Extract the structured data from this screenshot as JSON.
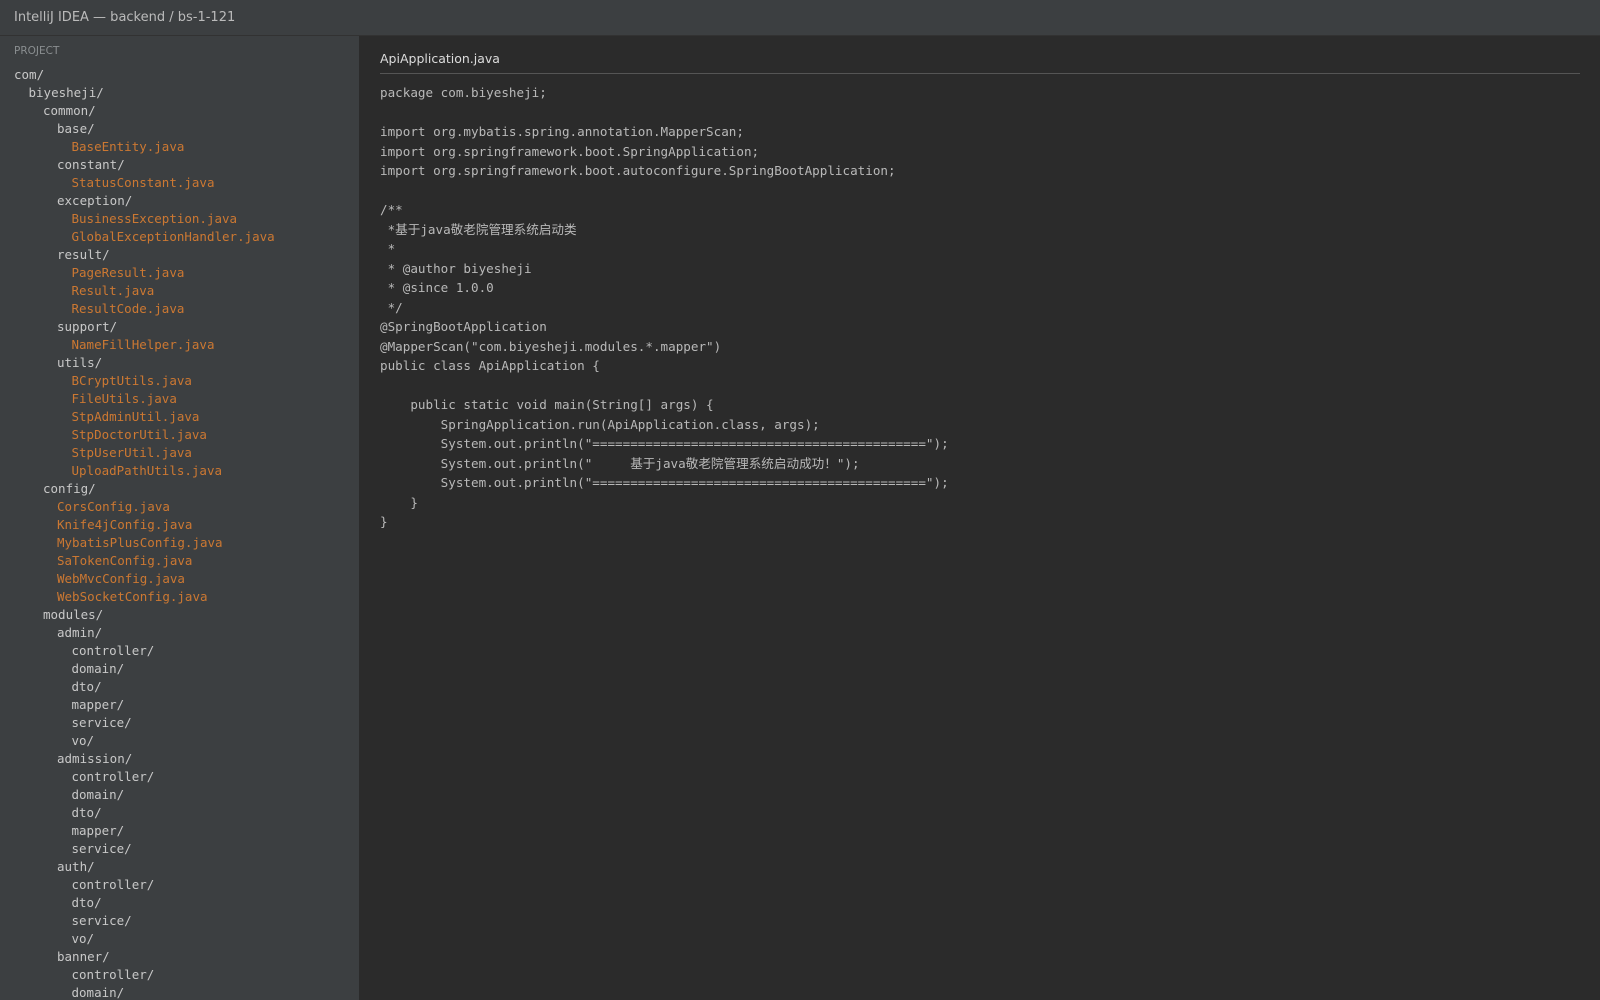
{
  "window": {
    "title": "IntelliJ IDEA — backend / bs-1-121"
  },
  "sidebar": {
    "section_title": "PROJECT",
    "tree": [
      {
        "label": "com/",
        "depth": 0,
        "kind": "dir"
      },
      {
        "label": "biyesheji/",
        "depth": 1,
        "kind": "dir"
      },
      {
        "label": "common/",
        "depth": 2,
        "kind": "dir"
      },
      {
        "label": "base/",
        "depth": 3,
        "kind": "dir"
      },
      {
        "label": "BaseEntity.java",
        "depth": 4,
        "kind": "file"
      },
      {
        "label": "constant/",
        "depth": 3,
        "kind": "dir"
      },
      {
        "label": "StatusConstant.java",
        "depth": 4,
        "kind": "file"
      },
      {
        "label": "exception/",
        "depth": 3,
        "kind": "dir"
      },
      {
        "label": "BusinessException.java",
        "depth": 4,
        "kind": "file"
      },
      {
        "label": "GlobalExceptionHandler.java",
        "depth": 4,
        "kind": "file"
      },
      {
        "label": "result/",
        "depth": 3,
        "kind": "dir"
      },
      {
        "label": "PageResult.java",
        "depth": 4,
        "kind": "file"
      },
      {
        "label": "Result.java",
        "depth": 4,
        "kind": "file"
      },
      {
        "label": "ResultCode.java",
        "depth": 4,
        "kind": "file"
      },
      {
        "label": "support/",
        "depth": 3,
        "kind": "dir"
      },
      {
        "label": "NameFillHelper.java",
        "depth": 4,
        "kind": "file"
      },
      {
        "label": "utils/",
        "depth": 3,
        "kind": "dir"
      },
      {
        "label": "BCryptUtils.java",
        "depth": 4,
        "kind": "file"
      },
      {
        "label": "FileUtils.java",
        "depth": 4,
        "kind": "file"
      },
      {
        "label": "StpAdminUtil.java",
        "depth": 4,
        "kind": "file"
      },
      {
        "label": "StpDoctorUtil.java",
        "depth": 4,
        "kind": "file"
      },
      {
        "label": "StpUserUtil.java",
        "depth": 4,
        "kind": "file"
      },
      {
        "label": "UploadPathUtils.java",
        "depth": 4,
        "kind": "file"
      },
      {
        "label": "config/",
        "depth": 2,
        "kind": "dir"
      },
      {
        "label": "CorsConfig.java",
        "depth": 3,
        "kind": "file"
      },
      {
        "label": "Knife4jConfig.java",
        "depth": 3,
        "kind": "file"
      },
      {
        "label": "MybatisPlusConfig.java",
        "depth": 3,
        "kind": "file"
      },
      {
        "label": "SaTokenConfig.java",
        "depth": 3,
        "kind": "file"
      },
      {
        "label": "WebMvcConfig.java",
        "depth": 3,
        "kind": "file"
      },
      {
        "label": "WebSocketConfig.java",
        "depth": 3,
        "kind": "file"
      },
      {
        "label": "modules/",
        "depth": 2,
        "kind": "dir"
      },
      {
        "label": "admin/",
        "depth": 3,
        "kind": "dir"
      },
      {
        "label": "controller/",
        "depth": 4,
        "kind": "dir"
      },
      {
        "label": "domain/",
        "depth": 4,
        "kind": "dir"
      },
      {
        "label": "dto/",
        "depth": 4,
        "kind": "dir"
      },
      {
        "label": "mapper/",
        "depth": 4,
        "kind": "dir"
      },
      {
        "label": "service/",
        "depth": 4,
        "kind": "dir"
      },
      {
        "label": "vo/",
        "depth": 4,
        "kind": "dir"
      },
      {
        "label": "admission/",
        "depth": 3,
        "kind": "dir"
      },
      {
        "label": "controller/",
        "depth": 4,
        "kind": "dir"
      },
      {
        "label": "domain/",
        "depth": 4,
        "kind": "dir"
      },
      {
        "label": "dto/",
        "depth": 4,
        "kind": "dir"
      },
      {
        "label": "mapper/",
        "depth": 4,
        "kind": "dir"
      },
      {
        "label": "service/",
        "depth": 4,
        "kind": "dir"
      },
      {
        "label": "auth/",
        "depth": 3,
        "kind": "dir"
      },
      {
        "label": "controller/",
        "depth": 4,
        "kind": "dir"
      },
      {
        "label": "dto/",
        "depth": 4,
        "kind": "dir"
      },
      {
        "label": "service/",
        "depth": 4,
        "kind": "dir"
      },
      {
        "label": "vo/",
        "depth": 4,
        "kind": "dir"
      },
      {
        "label": "banner/",
        "depth": 3,
        "kind": "dir"
      },
      {
        "label": "controller/",
        "depth": 4,
        "kind": "dir"
      },
      {
        "label": "domain/",
        "depth": 4,
        "kind": "dir"
      }
    ]
  },
  "editor": {
    "tab_label": "ApiApplication.java",
    "code_lines": [
      "package com.biyesheji;",
      "",
      "import org.mybatis.spring.annotation.MapperScan;",
      "import org.springframework.boot.SpringApplication;",
      "import org.springframework.boot.autoconfigure.SpringBootApplication;",
      "",
      "/**",
      " *基于java敬老院管理系统启动类",
      " *",
      " * @author biyesheji",
      " * @since 1.0.0",
      " */",
      "@SpringBootApplication",
      "@MapperScan(\"com.biyesheji.modules.*.mapper\")",
      "public class ApiApplication {",
      "",
      "    public static void main(String[] args) {",
      "        SpringApplication.run(ApiApplication.class, args);",
      "        System.out.println(\"============================================\");",
      "        System.out.println(\"     基于java敬老院管理系统启动成功！\");",
      "        System.out.println(\"============================================\");",
      "    }",
      "}"
    ]
  },
  "colors": {
    "window_bg": "#2b2b2b",
    "panel_bg": "#3c3f41",
    "dir_text": "#c8c8c8",
    "file_text": "#cc7832",
    "code_text": "#b9b9b9"
  }
}
